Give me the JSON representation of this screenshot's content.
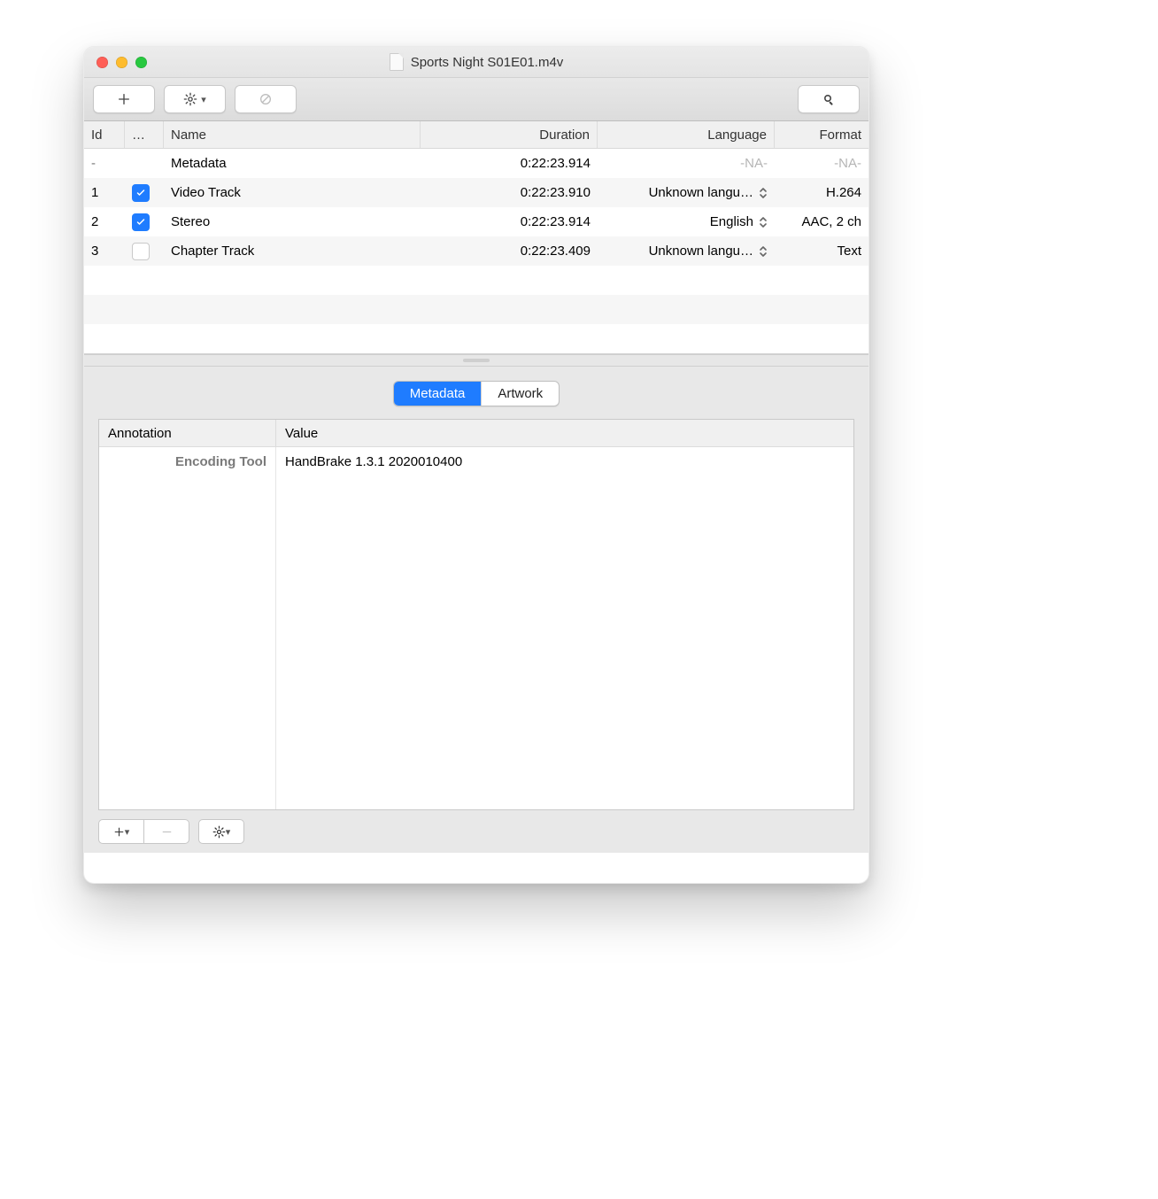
{
  "window": {
    "title": "Sports Night S01E01.m4v"
  },
  "tracks": {
    "columns": {
      "id": "Id",
      "enabled": "…",
      "name": "Name",
      "duration": "Duration",
      "language": "Language",
      "format": "Format"
    },
    "rows": [
      {
        "id": "-",
        "enabled": null,
        "name": "Metadata",
        "duration": "0:22:23.914",
        "language": "-NA-",
        "language_popup": false,
        "format": "-NA-"
      },
      {
        "id": "1",
        "enabled": true,
        "name": "Video Track",
        "duration": "0:22:23.910",
        "language": "Unknown langu…",
        "language_popup": true,
        "format": "H.264"
      },
      {
        "id": "2",
        "enabled": true,
        "name": "Stereo",
        "duration": "0:22:23.914",
        "language": "English",
        "language_popup": true,
        "format": "AAC, 2 ch"
      },
      {
        "id": "3",
        "enabled": false,
        "name": "Chapter Track",
        "duration": "0:22:23.409",
        "language": "Unknown langu…",
        "language_popup": true,
        "format": "Text"
      }
    ]
  },
  "tabs": {
    "metadata": "Metadata",
    "artwork": "Artwork",
    "active": "metadata"
  },
  "metadata": {
    "columns": {
      "annotation": "Annotation",
      "value": "Value"
    },
    "rows": [
      {
        "annotation": "Encoding Tool",
        "value": "HandBrake 1.3.1 2020010400"
      }
    ]
  }
}
